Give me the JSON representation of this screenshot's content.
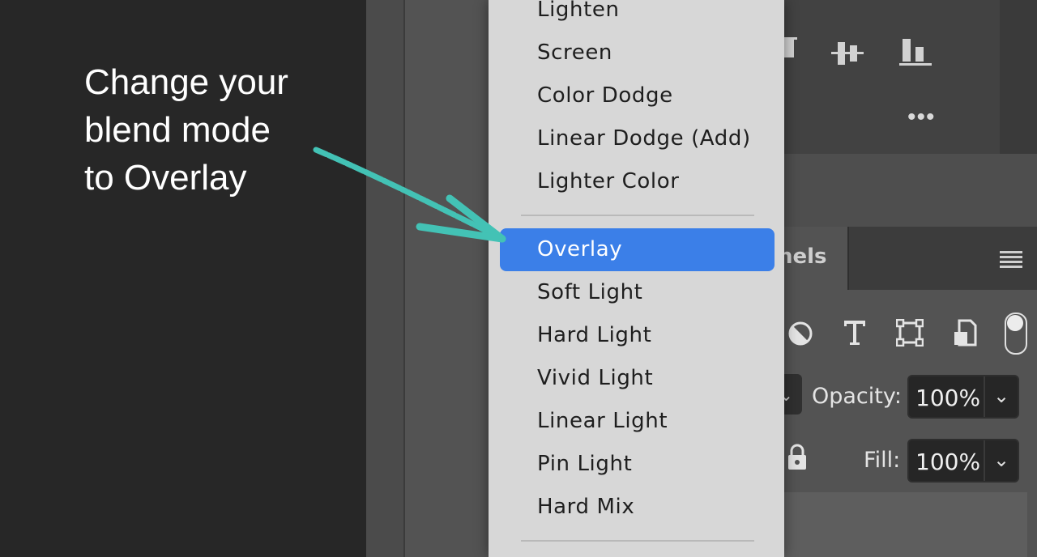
{
  "annotation": {
    "lines": [
      "Change your",
      "blend mode",
      "to Overlay"
    ]
  },
  "colors": {
    "accent": "#3b7fe8",
    "arrow": "#43c2b5",
    "menu_bg": "#d7d7d7"
  },
  "blend_menu": {
    "items": [
      {
        "label": "Lighten"
      },
      {
        "label": "Screen"
      },
      {
        "label": "Color Dodge"
      },
      {
        "label": "Linear Dodge (Add)"
      },
      {
        "label": "Lighter Color"
      },
      {
        "label": "Overlay",
        "selected": true
      },
      {
        "label": "Soft Light"
      },
      {
        "label": "Hard Light"
      },
      {
        "label": "Vivid Light"
      },
      {
        "label": "Linear Light"
      },
      {
        "label": "Pin Light"
      },
      {
        "label": "Hard Mix"
      }
    ]
  },
  "layers_panel": {
    "tab_label": "nels",
    "opacity_label": "Opacity:",
    "opacity_value": "100%",
    "fill_label": "Fill:",
    "fill_value": "100%"
  },
  "icons": [
    "align-top-icon",
    "align-vertical-center-icon",
    "align-bottom-icon",
    "more-options-icon",
    "panel-menu-icon",
    "adjustment-filter-icon",
    "type-filter-icon",
    "shape-filter-icon",
    "smart-object-filter-icon",
    "filter-toggle-icon",
    "lock-icon",
    "chevron-down-icon",
    "arrow-icon"
  ]
}
